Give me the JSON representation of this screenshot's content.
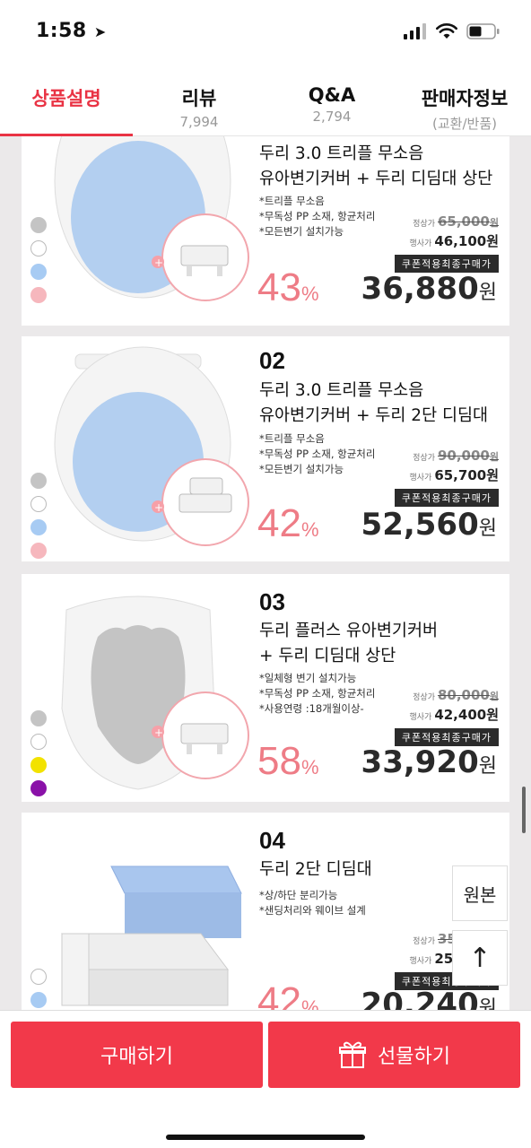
{
  "status": {
    "time": "1:58"
  },
  "tabs": [
    {
      "label": "상품설명",
      "sub": ""
    },
    {
      "label": "리뷰",
      "sub": "7,994"
    },
    {
      "label": "Q&A",
      "sub": "2,794"
    },
    {
      "label": "판매자정보",
      "sub": "(교환/반품)"
    }
  ],
  "products": [
    {
      "num": "",
      "title_line1": "두리 3.0 트리플 무소음",
      "title_line2": "유아변기커버 + 두리 디딤대 상단",
      "features": [
        "*트리플 무소음",
        "*무독성 PP 소재, 항균처리",
        "*모든변기 설치가능"
      ],
      "orig_label": "정상가",
      "orig_price": "65,000",
      "sale_label": "행사가",
      "sale_price": "46,100원",
      "coupon": "쿠폰적용최종구매가",
      "discount": "43",
      "pct": "%",
      "final_price": "36,880",
      "won": "원",
      "swatch_colors": [
        "#c4c4c4",
        "#ffffff",
        "#a7cbf3",
        "#f6b7bd"
      ]
    },
    {
      "num": "02",
      "title_line1": "두리 3.0 트리플 무소음",
      "title_line2": "유아변기커버 + 두리 2단 디딤대",
      "features": [
        "*트리플 무소음",
        "*무독성 PP 소재, 항균처리",
        "*모든변기 설치가능"
      ],
      "orig_label": "정상가",
      "orig_price": "90,000",
      "sale_label": "행사가",
      "sale_price": "65,700원",
      "coupon": "쿠폰적용최종구매가",
      "discount": "42",
      "pct": "%",
      "final_price": "52,560",
      "won": "원",
      "swatch_colors": [
        "#c4c4c4",
        "#ffffff",
        "#a7cbf3",
        "#f6b7bd"
      ]
    },
    {
      "num": "03",
      "title_line1": "두리 플러스 유아변기커버",
      "title_line2": "+ 두리 디딤대 상단",
      "features": [
        "*일체형 변기 설치가능",
        "*무독성 PP 소재, 항균처리",
        "*사용연령 :18개월이상-"
      ],
      "orig_label": "정상가",
      "orig_price": "80,000",
      "sale_label": "행사가",
      "sale_price": "42,400원",
      "coupon": "쿠폰적용최종구매가",
      "discount": "58",
      "pct": "%",
      "final_price": "33,920",
      "won": "원",
      "swatch_colors": [
        "#c4c4c4",
        "#ffffff",
        "#f2e200",
        "#8a11a8"
      ]
    },
    {
      "num": "04",
      "title_line1": "두리 2단 디딤대",
      "title_line2": "",
      "features": [
        "*상/하단 분리가능",
        "*샌딩처리와 웨이브 설계"
      ],
      "orig_label": "정상가",
      "orig_price": "35,000",
      "sale_label": "행사가",
      "sale_price": "25,300원",
      "coupon": "쿠폰적용최종구매가",
      "discount": "42",
      "pct": "%",
      "final_price": "20,240",
      "won": "원",
      "swatch_colors": [
        "#ffffff",
        "#a7cbf3"
      ]
    }
  ],
  "floating": {
    "original_label": "원본",
    "top_arrow": "↑"
  },
  "bottom": {
    "buy_label": "구매하기",
    "gift_label": "선물하기"
  }
}
